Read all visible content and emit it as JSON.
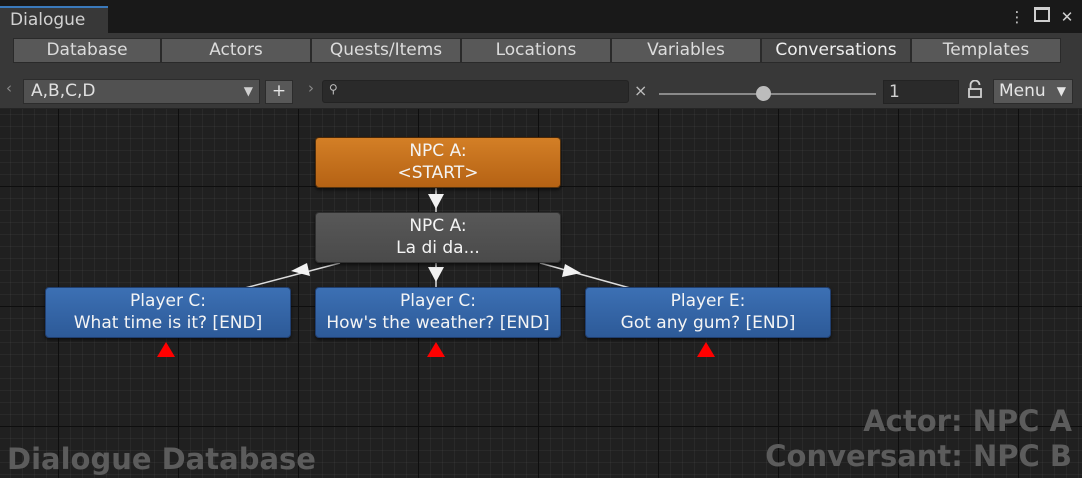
{
  "window": {
    "title": "Dialogue",
    "menu_icon": "kebab-menu-icon",
    "maximize_icon": "maximize-icon",
    "close_icon": "close-icon"
  },
  "tabs": [
    {
      "label": "Database",
      "active": false
    },
    {
      "label": "Actors",
      "active": false
    },
    {
      "label": "Quests/Items",
      "active": false
    },
    {
      "label": "Locations",
      "active": false
    },
    {
      "label": "Variables",
      "active": false
    },
    {
      "label": "Conversations",
      "active": true
    },
    {
      "label": "Templates",
      "active": false
    }
  ],
  "toolbar": {
    "conversation_select": "A,B,C,D",
    "add_label": "+",
    "search_value": "",
    "clear_label": "×",
    "zoom_slider": 0.48,
    "zoom_value": "1",
    "menu_label": "Menu"
  },
  "nodes": {
    "start": {
      "actor": "NPC A:",
      "text": "<START>"
    },
    "npc": {
      "actor": "NPC A:",
      "text": "La di da..."
    },
    "responses": [
      {
        "actor": "Player C:",
        "text": "What time is it? [END]"
      },
      {
        "actor": "Player C:",
        "text": "How's the weather? [END]"
      },
      {
        "actor": "Player E:",
        "text": "Got any gum? [END]"
      }
    ]
  },
  "watermarks": {
    "database": "Dialogue Database",
    "actor": "Actor: NPC A",
    "conversant": "Conversant: NPC B"
  },
  "colors": {
    "start_node": "#c46f1d",
    "npc_node": "#525252",
    "player_node": "#3465a6",
    "end_marker": "#ff0000",
    "active_tab_accent": "#3a79bb"
  }
}
